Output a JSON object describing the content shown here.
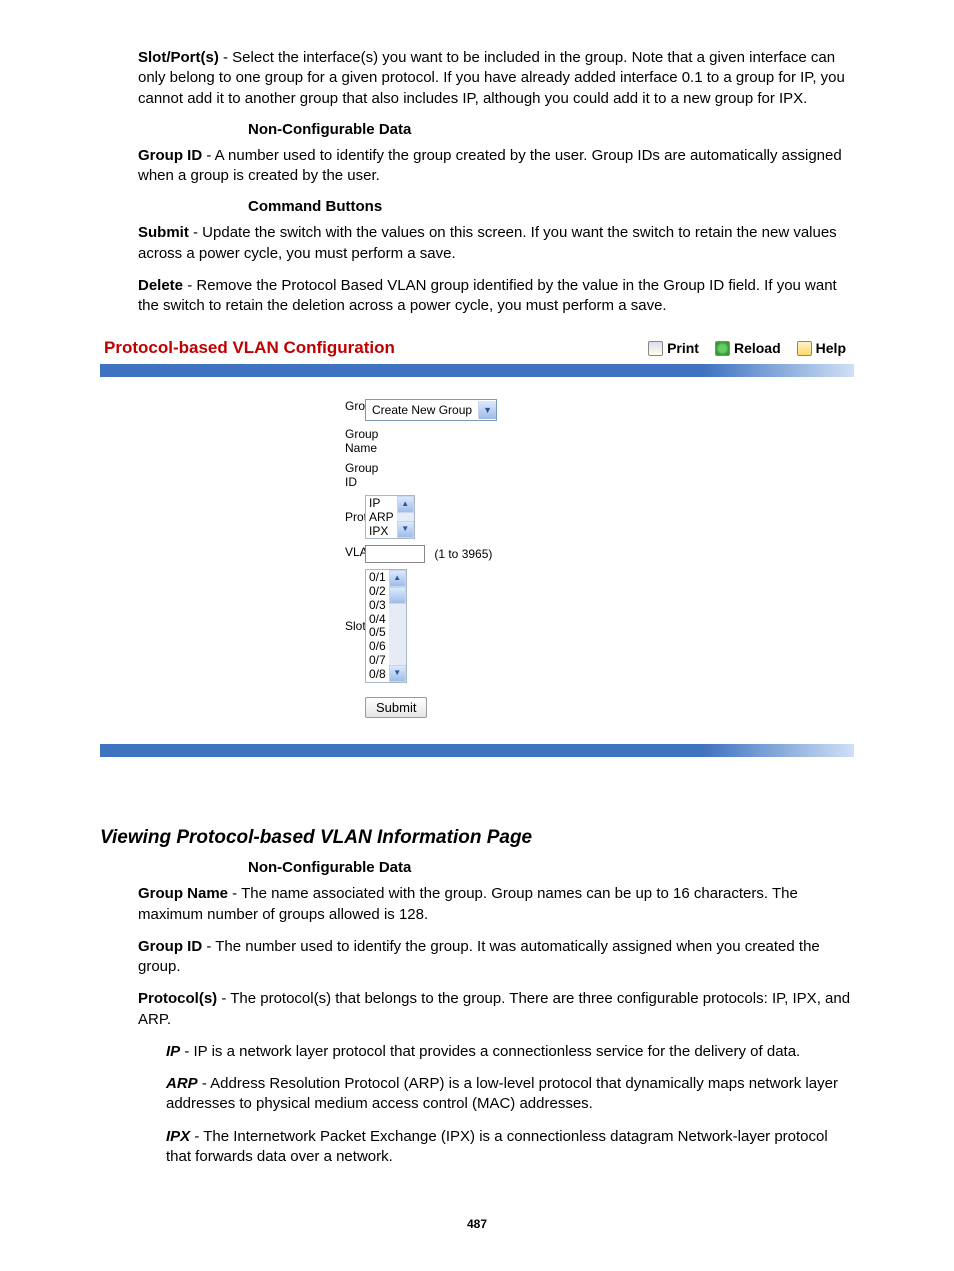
{
  "top": {
    "slotport": {
      "term": "Slot/Port(s)",
      "text": " - Select the interface(s) you want to be included in the group. Note that a given interface can only belong to one group for a given protocol. If you have already added interface 0.1 to a group for IP, you cannot add it to another group that also includes IP, although you could add it to a new group for IPX."
    },
    "heading1": "Non-Configurable Data",
    "groupid": {
      "term": "Group ID",
      "text": " - A number used to identify the group created by the user. Group IDs are automatically assigned when a group is created by the user."
    },
    "heading2": "Command Buttons",
    "submit": {
      "term": "Submit",
      "text": " - Update the switch with the values on this screen. If you want the switch to retain the new values across a power cycle, you must perform a save."
    },
    "delete": {
      "term": "Delete",
      "text": " - Remove the Protocol Based VLAN group identified by the value in the Group ID field. If you want the switch to retain the deletion across a power cycle, you must perform a save."
    }
  },
  "panel": {
    "title": "Protocol-based VLAN Configuration",
    "tools": {
      "print": "Print",
      "reload": "Reload",
      "help": "Help"
    },
    "labels": {
      "group": "Group",
      "groupname": "Group Name",
      "groupid": "Group ID",
      "protocols": "Protocols",
      "vlan": "VLAN",
      "slotport": "Slot/Port"
    },
    "group_select": "Create New Group",
    "protocols_list": [
      "IP",
      "ARP",
      "IPX"
    ],
    "vlan_hint": "(1 to 3965)",
    "slotport_list": [
      "0/1",
      "0/2",
      "0/3",
      "0/4",
      "0/5",
      "0/6",
      "0/7",
      "0/8"
    ],
    "submit": "Submit"
  },
  "bottom": {
    "section_title": "Viewing Protocol-based VLAN Information Page",
    "heading": "Non-Configurable Data",
    "groupname": {
      "term": "Group Name",
      "text": " - The name associated with the group. Group names can be up to 16 characters. The maximum number of groups allowed is 128."
    },
    "groupid": {
      "term": "Group ID",
      "text": " - The number used to identify the group. It was automatically assigned when you created the group."
    },
    "protocols": {
      "term": "Protocol(s)",
      "text": " - The protocol(s) that belongs to the group. There are three configurable protocols: IP, IPX, and ARP."
    },
    "ip": {
      "term": "IP",
      "text": " - IP is a network layer protocol that provides a connectionless service for the delivery of data."
    },
    "arp": {
      "term": "ARP",
      "text": " - Address Resolution Protocol (ARP) is a low-level protocol that dynamically maps network layer addresses to physical medium access control (MAC) addresses."
    },
    "ipx": {
      "term": "IPX",
      "text": " - The Internetwork Packet Exchange (IPX) is a connectionless datagram Network-layer protocol that forwards data over a network."
    }
  },
  "page_number": "487"
}
